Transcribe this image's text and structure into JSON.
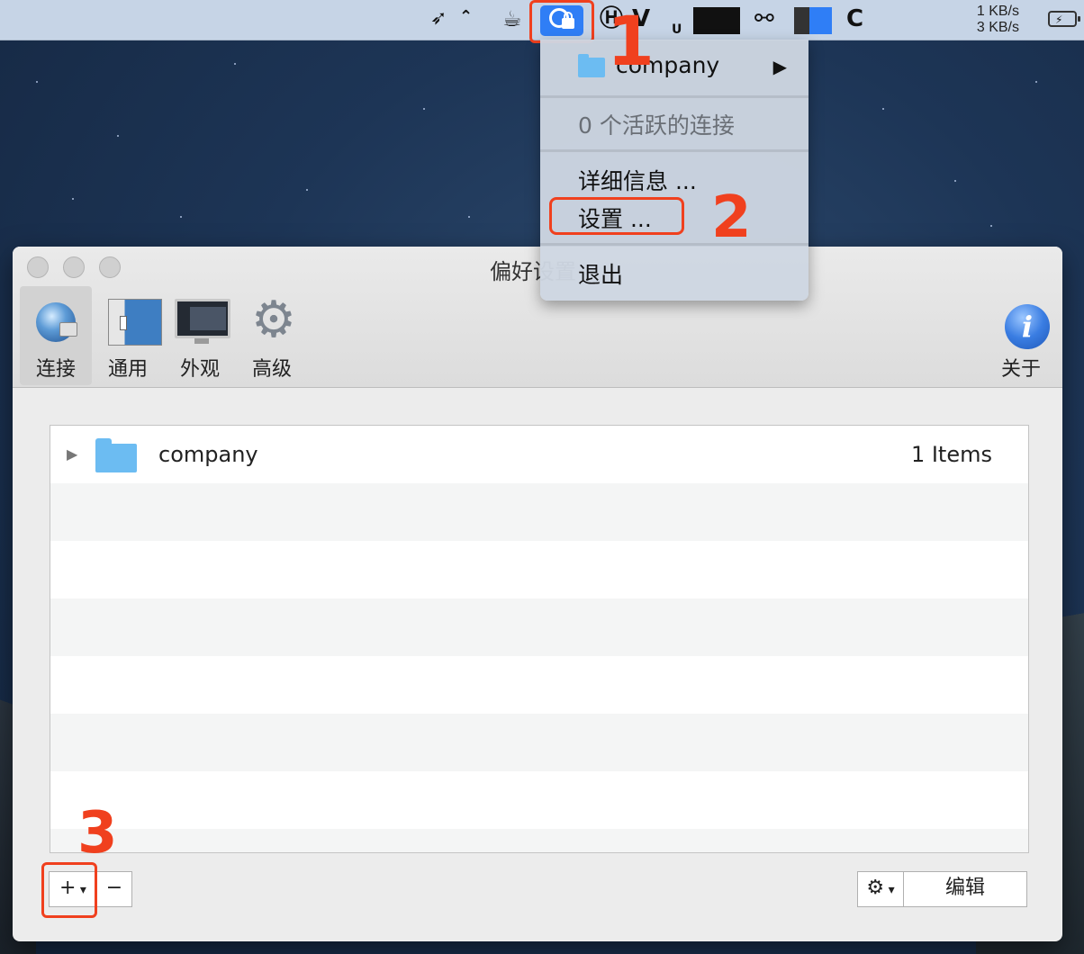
{
  "menubar": {
    "net_speed_up": "1 KB/s",
    "net_speed_down": "3 KB/s",
    "icons": [
      "rocket-icon",
      "cup-icon",
      "vpn-lock-icon",
      "h-icon",
      "v-icon",
      "u-icon",
      "keyboard-icon",
      "link-icon",
      "m-icon",
      "c-icon"
    ],
    "battery_icon": "battery-charging-icon"
  },
  "dropdown": {
    "submenu_label": "company",
    "status_label": "0 个活跃的连接",
    "details_label": "详细信息 ...",
    "settings_label": "设置 ...",
    "quit_label": "退出"
  },
  "window": {
    "title": "偏好设置",
    "toolbar": [
      {
        "label": "连接",
        "icon": "globe-lock-icon"
      },
      {
        "label": "通用",
        "icon": "general-switch-icon"
      },
      {
        "label": "外观",
        "icon": "monitor-icon"
      },
      {
        "label": "高级",
        "icon": "gear-icon"
      }
    ],
    "about_label": "关于",
    "list": [
      {
        "name": "company",
        "count": "1 Items"
      }
    ],
    "edit_button": "编辑",
    "add_button": "+",
    "remove_button": "−"
  },
  "annotations": {
    "step1": "1",
    "step2": "2",
    "step3": "3",
    "color": "#f0401e"
  },
  "colors": {
    "vpn_blue": "#2f7ef6",
    "folder_blue": "#6cbcf2"
  }
}
